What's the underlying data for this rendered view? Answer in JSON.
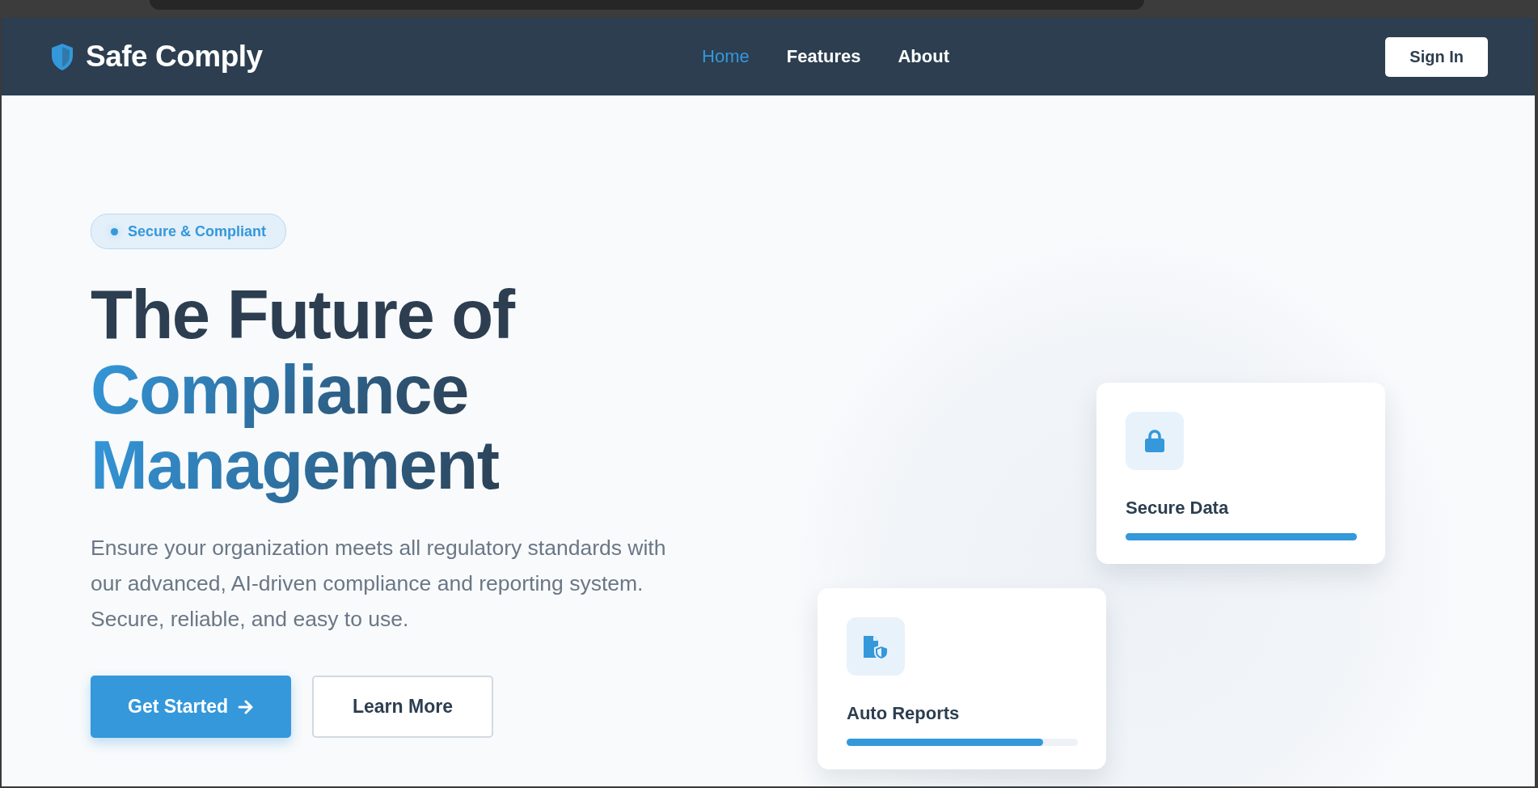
{
  "nav": {
    "brand": "Safe Comply",
    "links": [
      {
        "label": "Home",
        "selected": true
      },
      {
        "label": "Features",
        "selected": false
      },
      {
        "label": "About",
        "selected": false
      }
    ],
    "sign_in": "Sign In"
  },
  "hero": {
    "badge": "Secure & Compliant",
    "heading": {
      "plain": "The Future of",
      "highlight": "Compliance Management"
    },
    "description": "Ensure your organization meets all regulatory standards with our advanced, AI-driven compliance and reporting system. Secure, reliable, and easy to use.",
    "buttons": [
      {
        "label": "Get Started",
        "kind": "primary"
      },
      {
        "label": "Learn More",
        "kind": "secondary"
      }
    ]
  },
  "cards": [
    {
      "title": "Secure Data",
      "kind": "lock",
      "level": 1.0
    },
    {
      "title": "Auto Reports",
      "kind": "report",
      "level": 0.85
    }
  ]
}
